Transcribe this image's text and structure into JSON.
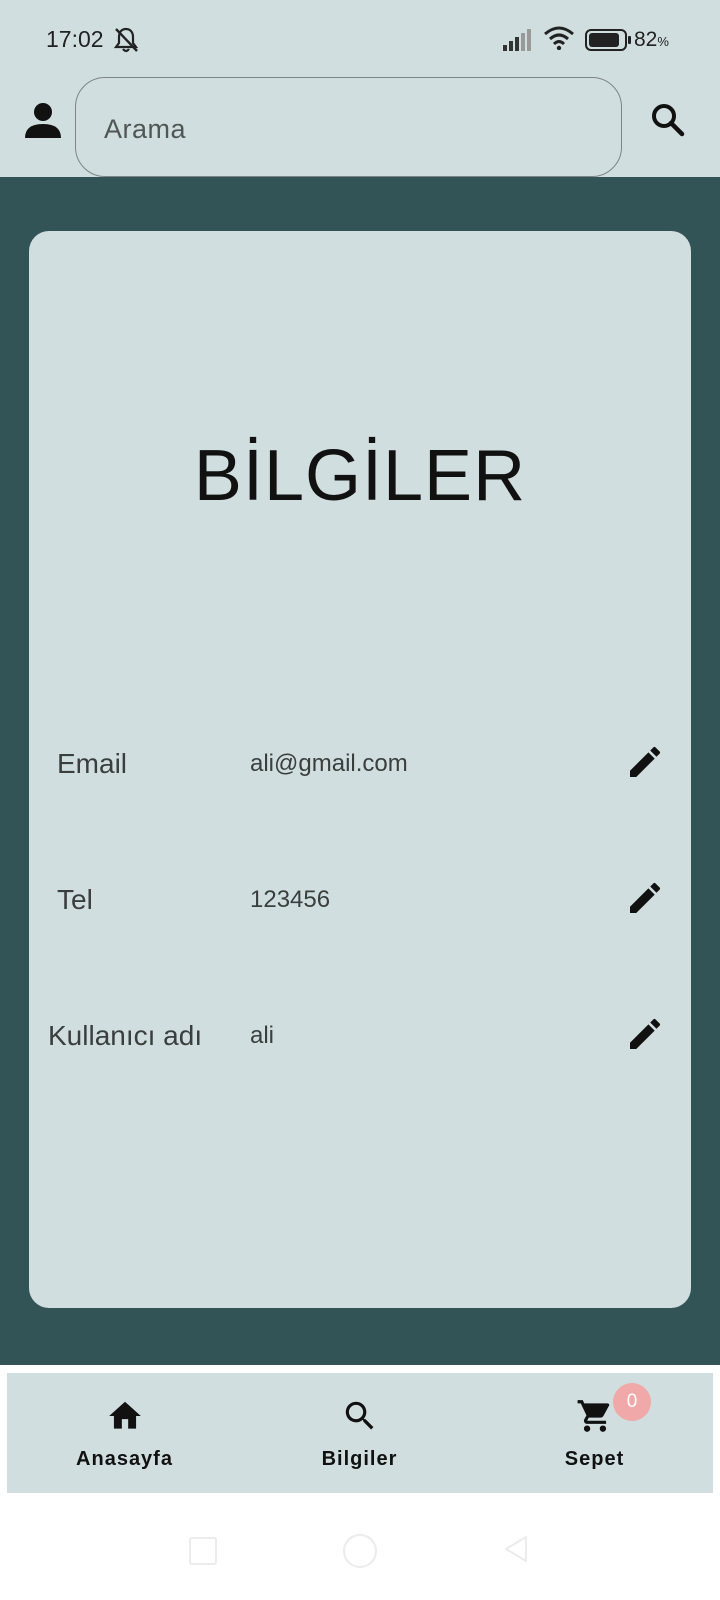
{
  "status_bar": {
    "time": "17:02",
    "battery_percent": "82",
    "battery_unit": "%"
  },
  "search": {
    "placeholder": "Arama"
  },
  "card": {
    "title": "BİLGİLER",
    "rows": [
      {
        "label": "Email",
        "value": "ali@gmail.com"
      },
      {
        "label": "Tel",
        "value": "123456"
      },
      {
        "label": "Kullanıcı adı",
        "value": "ali"
      }
    ]
  },
  "bottom_nav": {
    "items": [
      {
        "label": "Anasayfa",
        "icon": "home-icon"
      },
      {
        "label": "Bilgiler",
        "icon": "search-icon"
      },
      {
        "label": "Sepet",
        "icon": "cart-icon"
      }
    ],
    "cart_badge": "0"
  },
  "colors": {
    "header_bg": "#d1dedf",
    "main_bg": "#335456",
    "card_bg": "#d1dedf",
    "badge": "#f0a8a8"
  }
}
